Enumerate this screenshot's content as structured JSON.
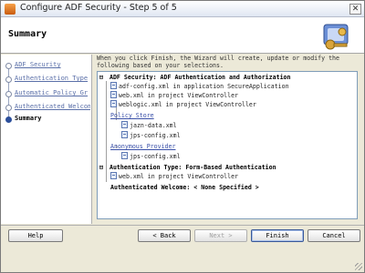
{
  "window": {
    "title": "Configure ADF Security - Step 5 of 5",
    "close_glyph": "✕"
  },
  "header": {
    "title": "Summary"
  },
  "nav": {
    "items": [
      {
        "label": "ADF Security"
      },
      {
        "label": "Authentication Type"
      },
      {
        "label": "Automatic Policy Gr"
      },
      {
        "label": "Authenticated Welcom"
      },
      {
        "label": "Summary"
      }
    ]
  },
  "main": {
    "intro": "When you click Finish, the Wizard will create, update or modify the following based on your selections.",
    "tree": {
      "adf_security": "ADF Security:  ADF Authentication and Authorization",
      "adf_config": "adf-config.xml in application SecureApplication",
      "web_xml": "web.xml in project ViewController",
      "weblogic_xml": "weblogic.xml in project ViewController",
      "policy_store": "Policy Store",
      "jazn_data": "jazn-data.xml",
      "jps_config_1": "jps-config.xml",
      "anonymous_provider": "Anonymous Provider",
      "jps_config_2": "jps-config.xml",
      "auth_type": "Authentication Type:  Form-Based Authentication",
      "web_xml_2": "web.xml in project ViewController",
      "auth_welcome": "Authenticated Welcome:  < None Specified >",
      "expand_glyph": "⊟"
    }
  },
  "buttons": {
    "help": "Help",
    "back": "< Back",
    "next": "Next >",
    "finish": "Finish",
    "cancel": "Cancel"
  }
}
